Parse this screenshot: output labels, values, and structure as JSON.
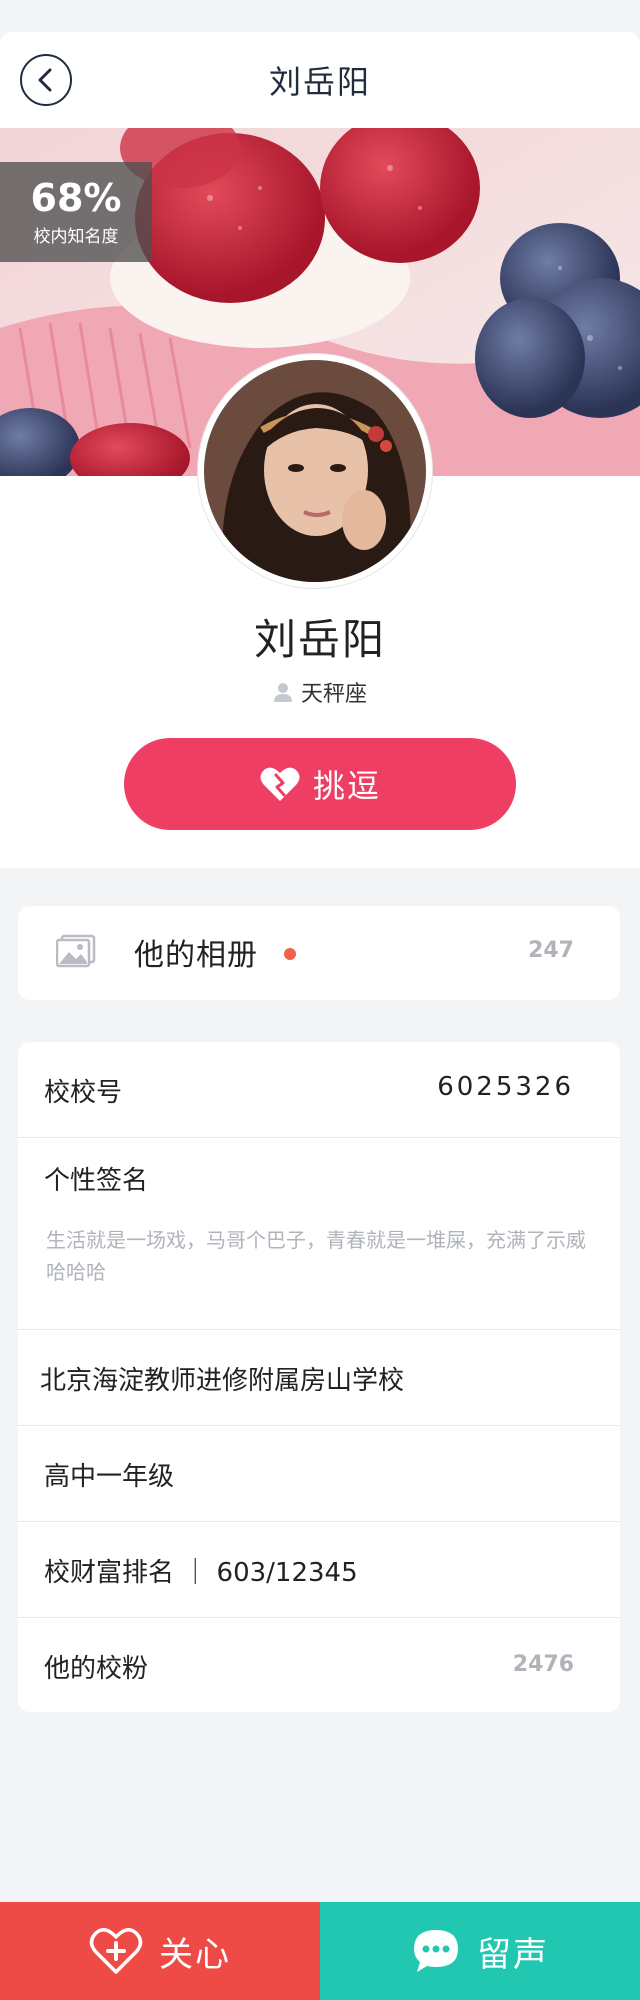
{
  "header": {
    "title": "刘岳阳",
    "back_icon": "chevron-left-icon"
  },
  "banner": {
    "popularity_value": "68%",
    "popularity_label": "校内知名度"
  },
  "profile": {
    "name": "刘岳阳",
    "zodiac": "天秤座",
    "zodiac_icon": "person-icon",
    "tease_button": "挑逗",
    "tease_icon": "heart-icon",
    "accent": "#ee3e64"
  },
  "album": {
    "label": "他的相册",
    "count": "247",
    "icon": "image-icon",
    "dot_color": "#f2624b"
  },
  "info": {
    "school_id_label": "校校号",
    "school_id_value": "6025326",
    "signature_label": "个性签名",
    "signature_text": "生活就是一场戏，马哥个巴子，青春就是一堆屎，充满了示威哈哈哈",
    "school_name": "北京海淀教师进修附属房山学校",
    "grade": "高中一年级",
    "wealth_rank": "校财富排名 ｜ 603/12345",
    "fans_label": "他的校粉",
    "fans_count": "2476"
  },
  "footer": {
    "care_label": "关心",
    "care_icon": "heart-plus-icon",
    "care_color": "#ef4b46",
    "message_label": "留声",
    "message_icon": "chat-bubble-icon",
    "message_color": "#22c7b1"
  }
}
